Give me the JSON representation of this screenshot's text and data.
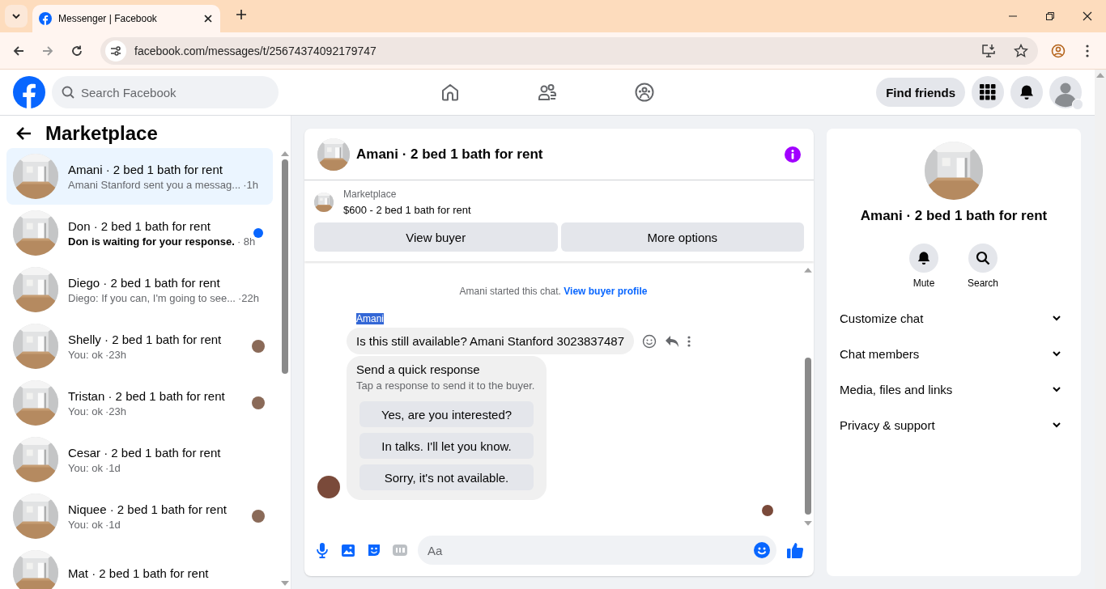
{
  "browser": {
    "tab_title": "Messenger | Facebook",
    "url": "facebook.com/messages/t/25674374092179747"
  },
  "header": {
    "search_placeholder": "Search Facebook",
    "find_friends": "Find friends"
  },
  "sidebar": {
    "title": "Marketplace",
    "conversations": [
      {
        "title": "Amani · 2 bed 1 bath for rent",
        "preview": "Amani Stanford sent you a messag...",
        "time": "·1h",
        "selected": true,
        "unread": false,
        "seen": false
      },
      {
        "title": "Don · 2 bed 1 bath for rent",
        "preview": "Don is waiting for your response.",
        "time": "· 8h",
        "selected": false,
        "unread": true,
        "seen": false
      },
      {
        "title": "Diego · 2 bed 1 bath for rent",
        "preview": "Diego: If you can, I'm going to see...",
        "time": "·22h",
        "selected": false,
        "unread": false,
        "seen": false
      },
      {
        "title": "Shelly · 2 bed 1 bath for rent",
        "preview": "You: ok",
        "time": "·23h",
        "selected": false,
        "unread": false,
        "seen": true
      },
      {
        "title": "Tristan · 2 bed 1 bath for rent",
        "preview": "You: ok",
        "time": "·23h",
        "selected": false,
        "unread": false,
        "seen": true
      },
      {
        "title": "Cesar · 2 bed 1 bath for rent",
        "preview": "You: ok",
        "time": "·1d",
        "selected": false,
        "unread": false,
        "seen": false
      },
      {
        "title": "Niquee · 2 bed 1 bath for rent",
        "preview": "You: ok",
        "time": "·1d",
        "selected": false,
        "unread": false,
        "seen": true
      },
      {
        "title": "Mat · 2 bed 1 bath for rent",
        "selected": false,
        "unread": false,
        "seen": false
      }
    ]
  },
  "chat": {
    "title": "Amani · 2 bed 1 bath for rent",
    "listing": {
      "label": "Marketplace",
      "summary": "$600 - 2 bed 1 bath for rent"
    },
    "buttons": [
      "View buyer",
      "More options"
    ],
    "notice": {
      "text": "Amani started this chat.",
      "link": "View buyer profile"
    },
    "sender": {
      "name": "Amani",
      "highlighted": true
    },
    "message": "Is this still available? Amani Stanford 3023837487",
    "quick_response": {
      "title": "Send a quick response",
      "subtitle": "Tap a response to send it to the buyer.",
      "options": [
        "Yes, are you interested?",
        "In talks. I'll let you know.",
        "Sorry, it's not available."
      ]
    },
    "composer": {
      "placeholder": "Aa"
    }
  },
  "info": {
    "title": "Amani · 2 bed 1 bath for rent",
    "actions": [
      {
        "kind": "mute",
        "label": "Mute"
      },
      {
        "kind": "search",
        "label": "Search"
      }
    ],
    "sections": [
      {
        "label": "Customize chat",
        "expanded": false
      },
      {
        "label": "Chat members",
        "expanded": false
      },
      {
        "label": "Media, files and links",
        "expanded": false
      },
      {
        "label": "Privacy & support",
        "expanded": false
      }
    ]
  }
}
